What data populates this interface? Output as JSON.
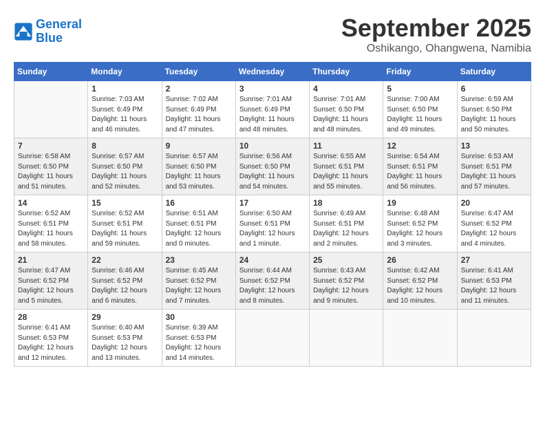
{
  "header": {
    "logo_line1": "General",
    "logo_line2": "Blue",
    "month": "September 2025",
    "location": "Oshikango, Ohangwena, Namibia"
  },
  "weekdays": [
    "Sunday",
    "Monday",
    "Tuesday",
    "Wednesday",
    "Thursday",
    "Friday",
    "Saturday"
  ],
  "weeks": [
    [
      {
        "day": "",
        "info": ""
      },
      {
        "day": "1",
        "info": "Sunrise: 7:03 AM\nSunset: 6:49 PM\nDaylight: 11 hours\nand 46 minutes."
      },
      {
        "day": "2",
        "info": "Sunrise: 7:02 AM\nSunset: 6:49 PM\nDaylight: 11 hours\nand 47 minutes."
      },
      {
        "day": "3",
        "info": "Sunrise: 7:01 AM\nSunset: 6:49 PM\nDaylight: 11 hours\nand 48 minutes."
      },
      {
        "day": "4",
        "info": "Sunrise: 7:01 AM\nSunset: 6:50 PM\nDaylight: 11 hours\nand 48 minutes."
      },
      {
        "day": "5",
        "info": "Sunrise: 7:00 AM\nSunset: 6:50 PM\nDaylight: 11 hours\nand 49 minutes."
      },
      {
        "day": "6",
        "info": "Sunrise: 6:59 AM\nSunset: 6:50 PM\nDaylight: 11 hours\nand 50 minutes."
      }
    ],
    [
      {
        "day": "7",
        "info": "Sunrise: 6:58 AM\nSunset: 6:50 PM\nDaylight: 11 hours\nand 51 minutes."
      },
      {
        "day": "8",
        "info": "Sunrise: 6:57 AM\nSunset: 6:50 PM\nDaylight: 11 hours\nand 52 minutes."
      },
      {
        "day": "9",
        "info": "Sunrise: 6:57 AM\nSunset: 6:50 PM\nDaylight: 11 hours\nand 53 minutes."
      },
      {
        "day": "10",
        "info": "Sunrise: 6:56 AM\nSunset: 6:50 PM\nDaylight: 11 hours\nand 54 minutes."
      },
      {
        "day": "11",
        "info": "Sunrise: 6:55 AM\nSunset: 6:51 PM\nDaylight: 11 hours\nand 55 minutes."
      },
      {
        "day": "12",
        "info": "Sunrise: 6:54 AM\nSunset: 6:51 PM\nDaylight: 11 hours\nand 56 minutes."
      },
      {
        "day": "13",
        "info": "Sunrise: 6:53 AM\nSunset: 6:51 PM\nDaylight: 11 hours\nand 57 minutes."
      }
    ],
    [
      {
        "day": "14",
        "info": "Sunrise: 6:52 AM\nSunset: 6:51 PM\nDaylight: 11 hours\nand 58 minutes."
      },
      {
        "day": "15",
        "info": "Sunrise: 6:52 AM\nSunset: 6:51 PM\nDaylight: 11 hours\nand 59 minutes."
      },
      {
        "day": "16",
        "info": "Sunrise: 6:51 AM\nSunset: 6:51 PM\nDaylight: 12 hours\nand 0 minutes."
      },
      {
        "day": "17",
        "info": "Sunrise: 6:50 AM\nSunset: 6:51 PM\nDaylight: 12 hours\nand 1 minute."
      },
      {
        "day": "18",
        "info": "Sunrise: 6:49 AM\nSunset: 6:51 PM\nDaylight: 12 hours\nand 2 minutes."
      },
      {
        "day": "19",
        "info": "Sunrise: 6:48 AM\nSunset: 6:52 PM\nDaylight: 12 hours\nand 3 minutes."
      },
      {
        "day": "20",
        "info": "Sunrise: 6:47 AM\nSunset: 6:52 PM\nDaylight: 12 hours\nand 4 minutes."
      }
    ],
    [
      {
        "day": "21",
        "info": "Sunrise: 6:47 AM\nSunset: 6:52 PM\nDaylight: 12 hours\nand 5 minutes."
      },
      {
        "day": "22",
        "info": "Sunrise: 6:46 AM\nSunset: 6:52 PM\nDaylight: 12 hours\nand 6 minutes."
      },
      {
        "day": "23",
        "info": "Sunrise: 6:45 AM\nSunset: 6:52 PM\nDaylight: 12 hours\nand 7 minutes."
      },
      {
        "day": "24",
        "info": "Sunrise: 6:44 AM\nSunset: 6:52 PM\nDaylight: 12 hours\nand 8 minutes."
      },
      {
        "day": "25",
        "info": "Sunrise: 6:43 AM\nSunset: 6:52 PM\nDaylight: 12 hours\nand 9 minutes."
      },
      {
        "day": "26",
        "info": "Sunrise: 6:42 AM\nSunset: 6:52 PM\nDaylight: 12 hours\nand 10 minutes."
      },
      {
        "day": "27",
        "info": "Sunrise: 6:41 AM\nSunset: 6:53 PM\nDaylight: 12 hours\nand 11 minutes."
      }
    ],
    [
      {
        "day": "28",
        "info": "Sunrise: 6:41 AM\nSunset: 6:53 PM\nDaylight: 12 hours\nand 12 minutes."
      },
      {
        "day": "29",
        "info": "Sunrise: 6:40 AM\nSunset: 6:53 PM\nDaylight: 12 hours\nand 13 minutes."
      },
      {
        "day": "30",
        "info": "Sunrise: 6:39 AM\nSunset: 6:53 PM\nDaylight: 12 hours\nand 14 minutes."
      },
      {
        "day": "",
        "info": ""
      },
      {
        "day": "",
        "info": ""
      },
      {
        "day": "",
        "info": ""
      },
      {
        "day": "",
        "info": ""
      }
    ]
  ]
}
